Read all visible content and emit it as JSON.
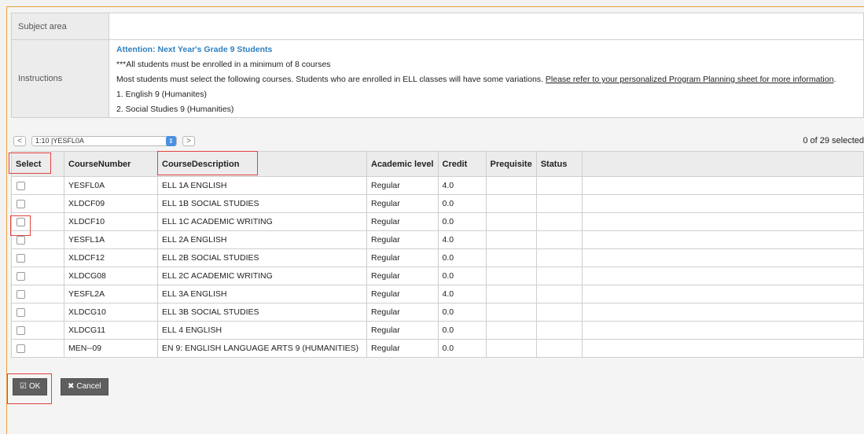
{
  "subject_area": {
    "label": "Subject area",
    "value": ""
  },
  "instructions": {
    "label": "Instructions",
    "title": "Attention: Next Year's Grade 9 Students",
    "line1": "***All students must be enrolled in a minimum of 8 courses",
    "line2_text": "Most students must select the following courses. Students who are enrolled in ELL classes will have some variations. ",
    "line2_link": "Please refer to your personalized Program Planning sheet for more information",
    "line2_end": ".",
    "line3": "1. English 9 (Humanites)",
    "line4": "2. Social Studies 9 (Humanities)"
  },
  "pager": {
    "prev": "<",
    "next": ">",
    "range": "1:10 |YESFL0A",
    "selected_count": "0 of 29 selected"
  },
  "grid": {
    "columns": [
      "Select",
      "CourseNumber",
      "CourseDescription",
      "Academic level",
      "Credit",
      "Prequisite",
      "Status",
      ""
    ],
    "rows": [
      {
        "num": "YESFL0A",
        "desc": "ELL 1A ENGLISH",
        "level": "Regular",
        "credit": "4.0",
        "prereq": "",
        "status": ""
      },
      {
        "num": "XLDCF09",
        "desc": "ELL 1B SOCIAL STUDIES",
        "level": "Regular",
        "credit": "0.0",
        "prereq": "",
        "status": ""
      },
      {
        "num": "XLDCF10",
        "desc": "ELL 1C ACADEMIC WRITING",
        "level": "Regular",
        "credit": "0.0",
        "prereq": "",
        "status": ""
      },
      {
        "num": "YESFL1A",
        "desc": "ELL 2A ENGLISH",
        "level": "Regular",
        "credit": "4.0",
        "prereq": "",
        "status": ""
      },
      {
        "num": "XLDCF12",
        "desc": "ELL 2B SOCIAL STUDIES",
        "level": "Regular",
        "credit": "0.0",
        "prereq": "",
        "status": ""
      },
      {
        "num": "XLDCG08",
        "desc": "ELL 2C ACADEMIC WRITING",
        "level": "Regular",
        "credit": "0.0",
        "prereq": "",
        "status": ""
      },
      {
        "num": "YESFL2A",
        "desc": "ELL 3A ENGLISH",
        "level": "Regular",
        "credit": "4.0",
        "prereq": "",
        "status": ""
      },
      {
        "num": "XLDCG10",
        "desc": "ELL 3B SOCIAL STUDIES",
        "level": "Regular",
        "credit": "0.0",
        "prereq": "",
        "status": ""
      },
      {
        "num": "XLDCG11",
        "desc": "ELL 4 ENGLISH",
        "level": "Regular",
        "credit": "0.0",
        "prereq": "",
        "status": ""
      },
      {
        "num": "MEN--09",
        "desc": "EN 9: ENGLISH LANGUAGE ARTS 9 (HUMANITIES)",
        "level": "Regular",
        "credit": "0.0",
        "prereq": "",
        "status": ""
      }
    ]
  },
  "buttons": {
    "ok": "OK",
    "cancel": "Cancel"
  },
  "colors": {
    "highlight": "#e0443e",
    "title_blue": "#2f7fbf",
    "button": "#5f5f5f",
    "frame_accent": "#e8a33a"
  }
}
